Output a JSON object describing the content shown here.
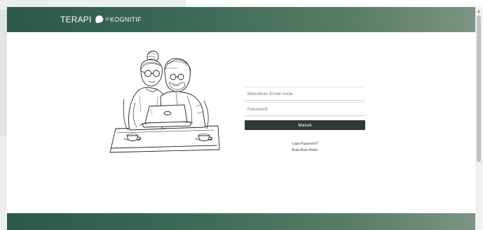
{
  "header": {
    "logo_part1": "TERAPI",
    "logo_mid": "dr",
    "logo_part2": "KOGNITIF"
  },
  "login": {
    "email_placeholder": "Masukkan Email Anda",
    "password_placeholder": "Password",
    "submit_label": "Masuk",
    "forgot_link": "Lupa Password?",
    "register_link": "Buat Akun Anda!"
  },
  "colors": {
    "header_start": "#2d5849",
    "header_end": "#7d9484",
    "button": "#2f3a38"
  },
  "icons": {
    "logo_head": "head-profile-icon",
    "illustration": "elderly-couple-laptop-illustration",
    "scroll_up": "scroll-up-arrow-icon"
  }
}
